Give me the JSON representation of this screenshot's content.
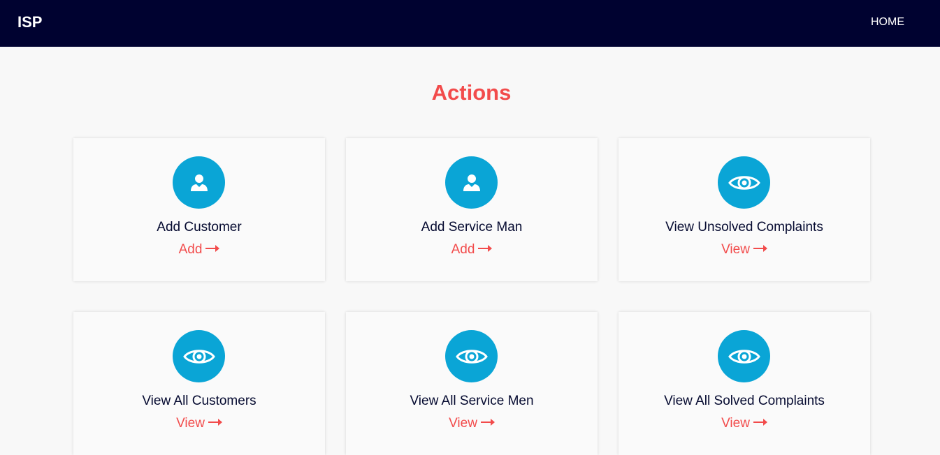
{
  "navbar": {
    "brand": "ISP",
    "home_label": "HOME"
  },
  "main": {
    "title": "Actions",
    "cards": [
      {
        "title": "Add Customer",
        "link": "Add",
        "icon": "user-icon"
      },
      {
        "title": "Add Service Man",
        "link": "Add",
        "icon": "user-icon"
      },
      {
        "title": "View Unsolved Complaints",
        "link": "View",
        "icon": "eye-icon"
      },
      {
        "title": "View All Customers",
        "link": "View",
        "icon": "eye-icon"
      },
      {
        "title": "View All Service Men",
        "link": "View",
        "icon": "eye-icon"
      },
      {
        "title": "View All Solved Complaints",
        "link": "View",
        "icon": "eye-icon"
      }
    ]
  },
  "colors": {
    "navbar_bg": "#000230",
    "accent": "#f24b4b",
    "icon_bg": "#0aa5d6",
    "text_dark": "#050a30",
    "page_bg": "#f8f8f8"
  }
}
